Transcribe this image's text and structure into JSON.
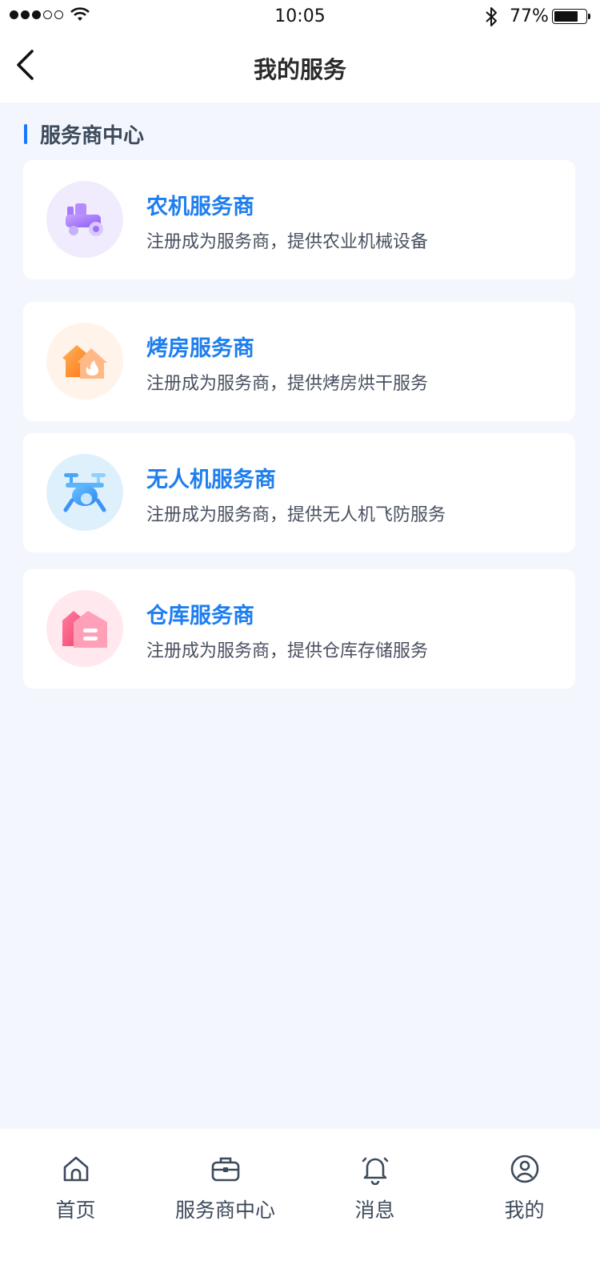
{
  "status_bar": {
    "time": "10:05",
    "battery_percent": "77%",
    "battery_level": 0.77,
    "signal_bars": 3,
    "signal_total": 5
  },
  "nav": {
    "title": "我的服务",
    "back_icon": "chevron-left-icon"
  },
  "section": {
    "title": "服务商中心",
    "accent_color": "#1677ff"
  },
  "services": [
    {
      "name": "农机服务商",
      "desc": "注册成为服务商，提供农业机械设备",
      "icon": "tractor-icon",
      "bg": "#f1ecfd"
    },
    {
      "name": "烤房服务商",
      "desc": "注册成为服务商，提供烤房烘干服务",
      "icon": "fire-house-icon",
      "bg": "#fff3ea"
    },
    {
      "name": "无人机服务商",
      "desc": "注册成为服务商，提供无人机飞防服务",
      "icon": "drone-icon",
      "bg": "#dff0fd"
    },
    {
      "name": "仓库服务商",
      "desc": "注册成为服务商，提供仓库存储服务",
      "icon": "warehouse-icon",
      "bg": "#ffe8ee"
    }
  ],
  "tabs": [
    {
      "label": "首页",
      "icon": "home-icon"
    },
    {
      "label": "服务商中心",
      "icon": "briefcase-icon"
    },
    {
      "label": "消息",
      "icon": "bell-icon"
    },
    {
      "label": "我的",
      "icon": "user-circle-icon"
    }
  ],
  "colors": {
    "page_bg": "#f3f7fd",
    "title_blue": "#1e7ef0",
    "text_dark": "#3d4a5c"
  }
}
